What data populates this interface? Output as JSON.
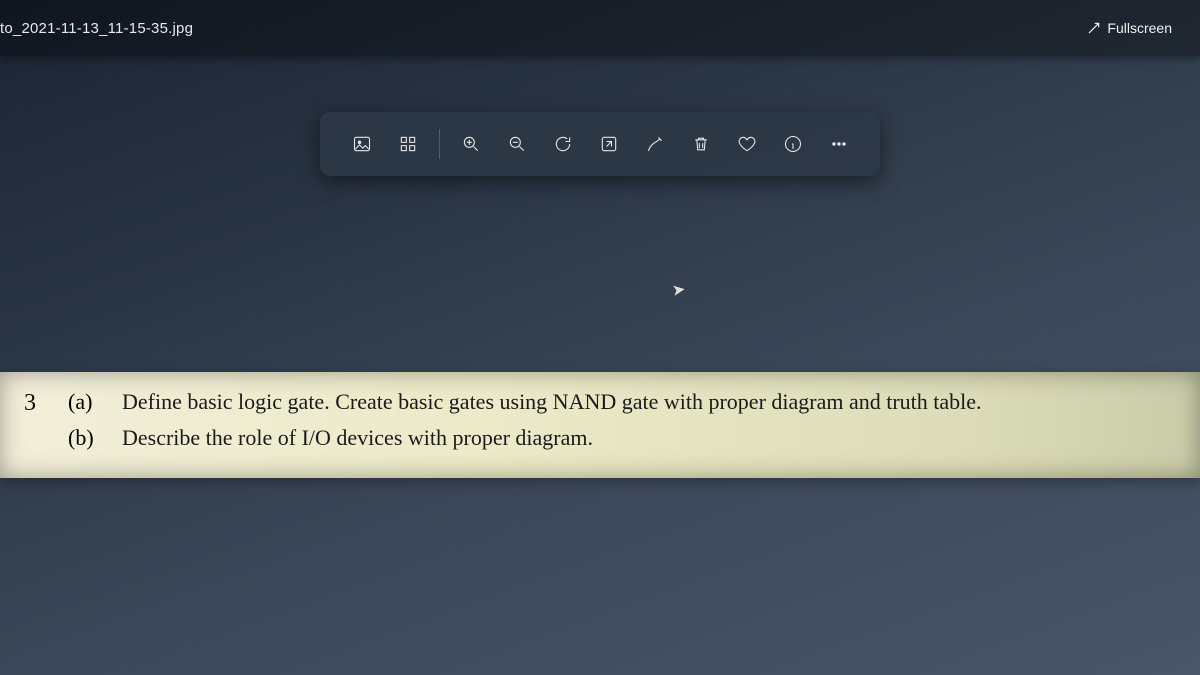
{
  "header": {
    "filename": "to_2021-11-13_11-15-35.jpg",
    "fullscreen_label": "Fullscreen"
  },
  "toolbar": {
    "items": [
      {
        "name": "image-icon"
      },
      {
        "name": "view-grid-icon"
      },
      {
        "name": "zoom-in-icon"
      },
      {
        "name": "zoom-out-icon"
      },
      {
        "name": "rotate-icon"
      },
      {
        "name": "expand-icon"
      },
      {
        "name": "edit-icon"
      },
      {
        "name": "delete-icon"
      },
      {
        "name": "favorite-icon"
      },
      {
        "name": "info-icon"
      },
      {
        "name": "more-icon"
      }
    ]
  },
  "document": {
    "question_number": "3",
    "parts": [
      {
        "label": "(a)",
        "text": "Define basic logic gate. Create basic gates using NAND gate with proper diagram and truth table."
      },
      {
        "label": "(b)",
        "text": "Describe the role of I/O devices with proper diagram."
      }
    ]
  }
}
